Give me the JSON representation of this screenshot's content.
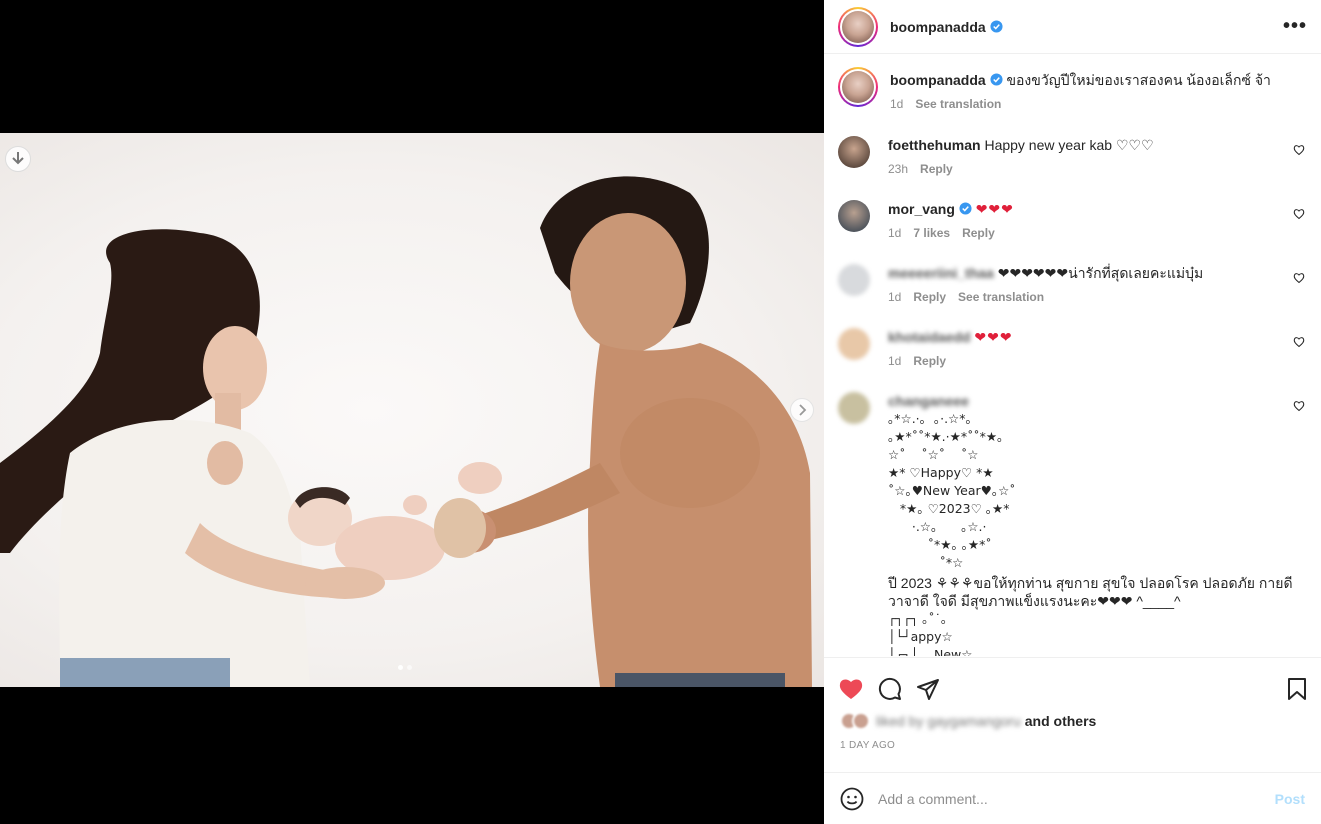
{
  "post": {
    "author": "boompanadda",
    "caption": "ของขวัญปีใหม่ของเราสองคน น้องอเล็กซ์ จ้า",
    "caption_time": "1d",
    "caption_translate": "See translation"
  },
  "comments": [
    {
      "user": "foetthehuman",
      "text": "Happy new year kab ♡♡♡",
      "time": "23h",
      "likes": "",
      "reply": "Reply",
      "translate": ""
    },
    {
      "user": "mor_vang",
      "text": "❤❤❤",
      "time": "1d",
      "likes": "7 likes",
      "reply": "Reply",
      "translate": ""
    },
    {
      "user": "meeeeriini_thaa",
      "text": "❤❤❤❤❤❤น่ารักที่สุดเลยคะแม่บุ๋ม",
      "time": "1d",
      "likes": "",
      "reply": "Reply",
      "translate": "See translation"
    },
    {
      "user": "khotaidaedd",
      "text": "❤❤❤",
      "time": "1d",
      "likes": "",
      "reply": "Reply",
      "translate": ""
    },
    {
      "user": "changaneee",
      "text_art": "｡*☆.·｡  ｡·.☆*｡\n｡★*˚˚*★.·★*˚˚*★｡\n☆˚    ˚☆˚    ˚☆\n★* ♡Happy♡ *★\n˚☆｡♥New Year♥｡☆˚\n   *★｡ ♡2023♡ ｡★*\n      ·.☆｡      ｡☆.·\n          ˚*★｡ ｡★*˚\n             ˚*☆",
      "text": "ปี 2023 ⚘⚘⚘ขอให้ทุกท่าน สุขกาย สุขใจ ปลอดโรค ปลอดภัย กายดี วาจาดี ใจดี มีสุขภาพแข็งแรงนะคะ❤❤❤ ^____^",
      "text_art2": "┌┐┌┐ ｡˚˙｡\n│└┘appy☆\n│┌┐│    New☆"
    }
  ],
  "actions": {
    "liked_by_blurred": "liked by gaygamangoru",
    "and_others": "and others",
    "date": "1 DAY AGO",
    "comment_placeholder": "Add a comment...",
    "post_label": "Post"
  },
  "colors": {
    "like_red": "#ed4956",
    "verified_blue": "#3897f0"
  }
}
